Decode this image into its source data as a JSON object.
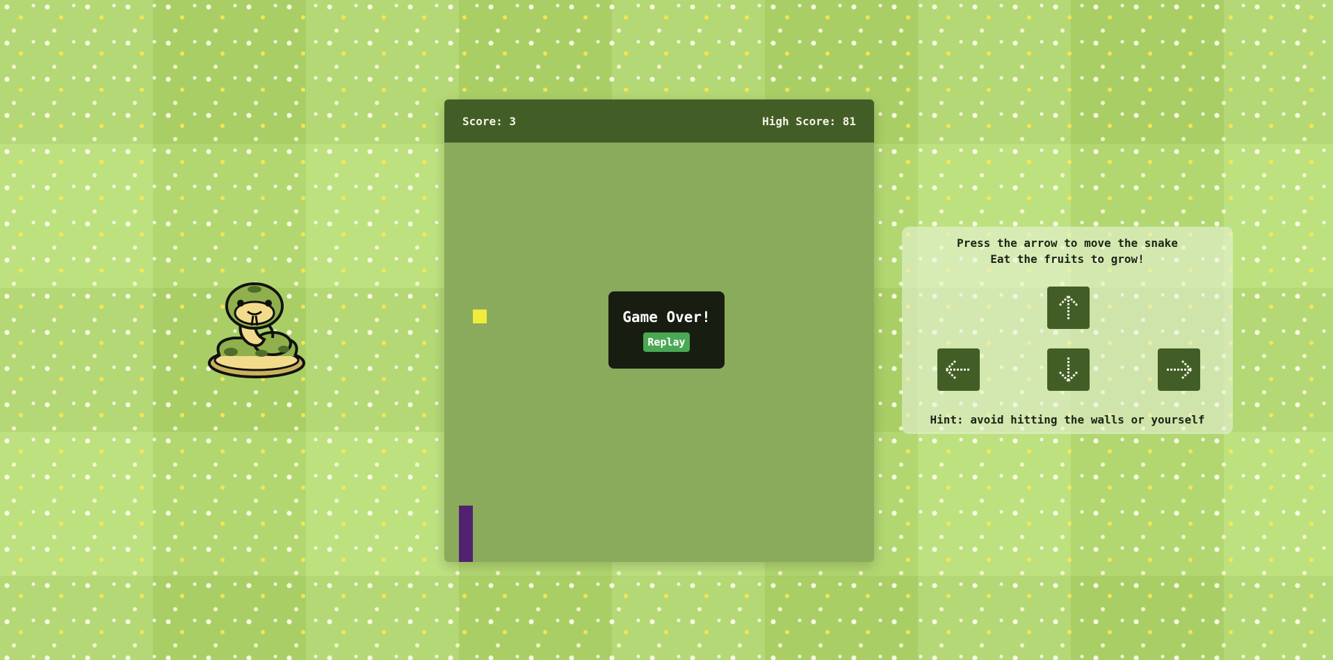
{
  "header": {
    "score_text": "Score: 3",
    "high_score_text": "High Score: 81"
  },
  "game_over": {
    "title": "Game Over!",
    "replay_label": "Replay"
  },
  "instructions": {
    "line1": "Press the arrow to move the snake",
    "line2": "Eat the fruits to grow!",
    "hint": "Hint: avoid hitting the walls or yourself"
  },
  "controls": {
    "up_icon": "arrow-up-icon",
    "down_icon": "arrow-down-icon",
    "left_icon": "arrow-left-icon",
    "right_icon": "arrow-right-icon"
  },
  "colors": {
    "header": "#425e26",
    "board": "#8aaa5c",
    "food": "#f0eb3c",
    "snake": "#51226f",
    "replay_button": "#4aa854",
    "control_button": "#425e26"
  }
}
